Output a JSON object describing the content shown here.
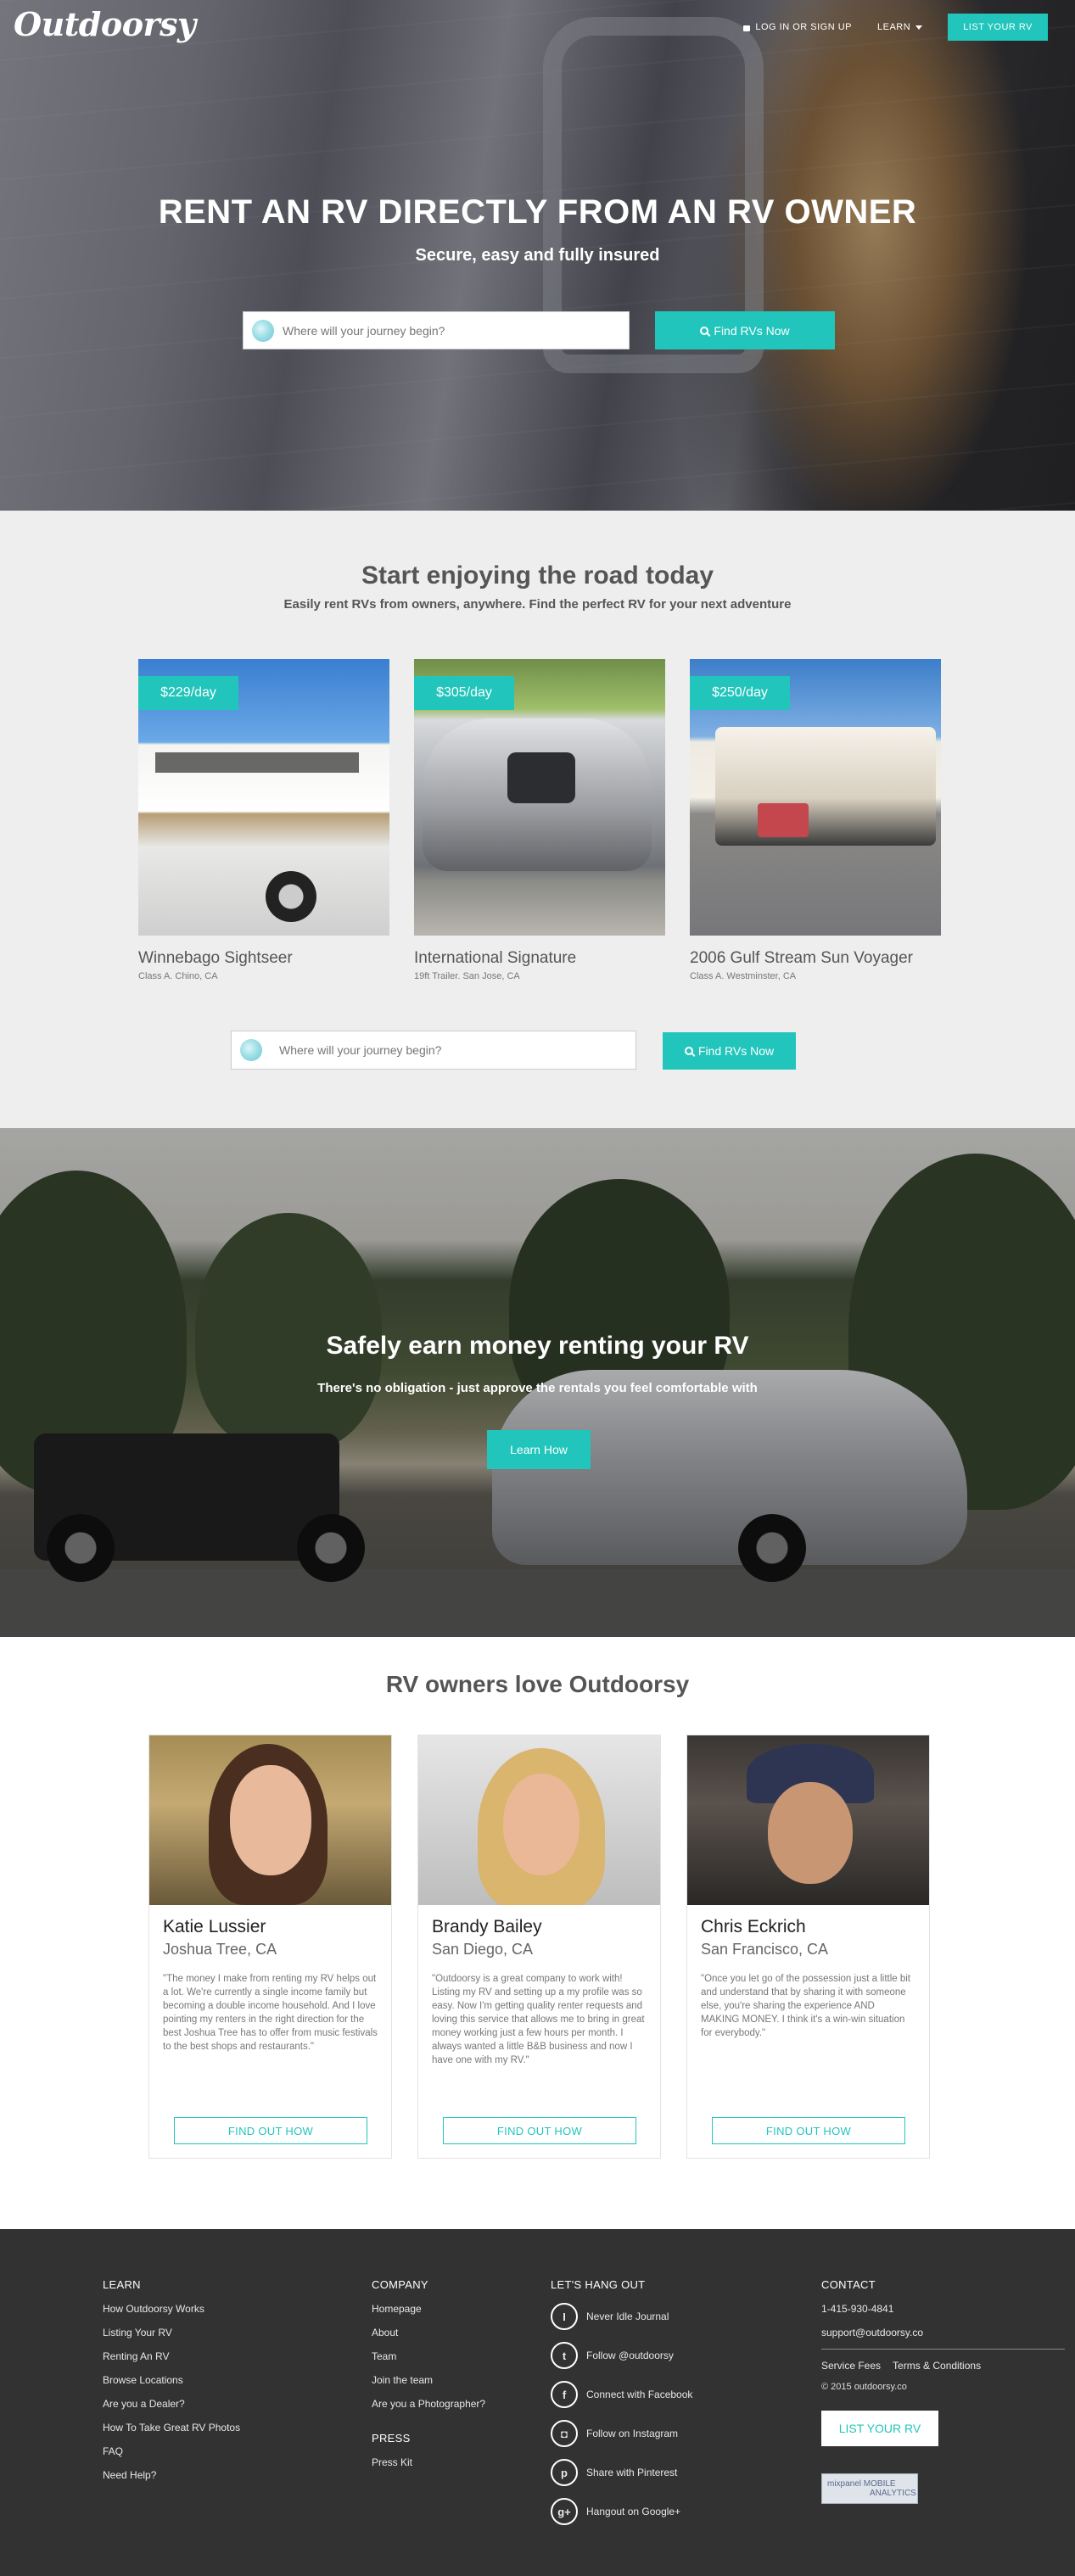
{
  "header": {
    "logo": "Outdoorsy",
    "login_label": "LOG IN OR SIGN UP",
    "learn_label": "LEARN",
    "list_rv_label": "LIST YOUR RV"
  },
  "hero": {
    "title": "RENT AN RV DIRECTLY FROM AN RV OWNER",
    "subtitle": "Secure, easy and fully insured",
    "search_placeholder": "Where will your journey begin?",
    "find_button": "Find RVs Now"
  },
  "start": {
    "title": "Start enjoying the road today",
    "subtitle": "Easily rent RVs from owners, anywhere. Find the perfect RV for your next adventure",
    "listings": [
      {
        "price": "$229/day",
        "name": "Winnebago Sightseer",
        "meta": "Class A. Chino, CA"
      },
      {
        "price": "$305/day",
        "name": "International Signature",
        "meta": "19ft Trailer. San Jose, CA"
      },
      {
        "price": "$250/day",
        "name": "2006 Gulf Stream Sun Voyager",
        "meta": "Class A. Westminster, CA"
      }
    ],
    "search_placeholder": "Where will your journey begin?",
    "find_button": "Find RVs Now"
  },
  "earn": {
    "title": "Safely earn money renting your RV",
    "subtitle": "There's no obligation - just approve the rentals you feel comfortable with",
    "button": "Learn How"
  },
  "owners": {
    "title": "RV owners love Outdoorsy",
    "cards": [
      {
        "name": "Katie Lussier",
        "location": "Joshua Tree, CA",
        "quote": "\"The money I make from renting my RV helps out a lot. We're currently a single income family but becoming a double income household. And I love pointing my renters in the right direction for the best Joshua Tree has to offer from music festivals to the best shops and restaurants.\"",
        "button": "FIND OUT HOW"
      },
      {
        "name": "Brandy Bailey",
        "location": "San Diego, CA",
        "quote": "\"Outdoorsy is a great company to work with! Listing my RV and setting up a my profile was so easy. Now I'm getting quality renter requests and loving this service that allows me to bring in great money working just a few hours per month. I always wanted a little B&B business and now I have one with my RV.\"",
        "button": "FIND OUT HOW"
      },
      {
        "name": "Chris Eckrich",
        "location": "San Francisco, CA",
        "quote": "\"Once you let go of the possession just a little bit and understand that by sharing it with someone else, you're sharing the experience AND MAKING MONEY. I think it's a win-win situation for everybody.\"",
        "button": "FIND OUT HOW"
      }
    ]
  },
  "footer": {
    "learn": {
      "heading": "LEARN",
      "links": [
        "How Outdoorsy Works",
        "Listing Your RV",
        "Renting An RV",
        "Browse Locations",
        "Are you a Dealer?",
        "How To Take Great RV Photos",
        "FAQ",
        "Need Help?"
      ]
    },
    "company": {
      "heading": "COMPANY",
      "links": [
        "Homepage",
        "About",
        "Team",
        "Join the team",
        "Are you a Photographer?"
      ],
      "press_heading": "PRESS",
      "press_links": [
        "Press Kit"
      ]
    },
    "social": {
      "heading": "LET'S HANG OUT",
      "items": [
        {
          "icon": "journal-icon",
          "glyph": "I",
          "label": "Never Idle Journal"
        },
        {
          "icon": "twitter-icon",
          "glyph": "t",
          "label": "Follow @outdoorsy"
        },
        {
          "icon": "facebook-icon",
          "glyph": "f",
          "label": "Connect with Facebook"
        },
        {
          "icon": "instagram-icon",
          "glyph": "◘",
          "label": "Follow on Instagram"
        },
        {
          "icon": "pinterest-icon",
          "glyph": "p",
          "label": "Share with Pinterest"
        },
        {
          "icon": "googleplus-icon",
          "glyph": "g+",
          "label": "Hangout on Google+"
        }
      ]
    },
    "contact": {
      "heading": "CONTACT",
      "phone": "1-415-930-4841",
      "email": "support@outdoorsy.co",
      "service_fees": "Service Fees",
      "terms": "Terms & Conditions",
      "copyright": "© 2015 outdoorsy.co",
      "list_rv_button": "LIST YOUR RV",
      "mixpanel_line1": "mixpanel MOBILE",
      "mixpanel_line2": "ANALYTICS"
    }
  },
  "colors": {
    "accent": "#22c5bb",
    "footer_bg": "#323232",
    "section_bg": "#eeeeee"
  }
}
